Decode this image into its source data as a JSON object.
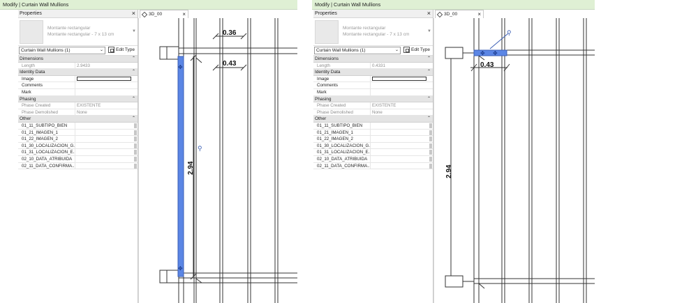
{
  "left": {
    "titlebar": "Modify | Curtain Wall Mullions",
    "properties": {
      "header": "Properties",
      "type_line1": "Montante rectangular",
      "type_line2": "Montante rectangular - 7 x 13 cm",
      "selector": "Curtain Wall Mullions (1)",
      "edit_type": "Edit Type",
      "groups": {
        "dimensions": "Dimensions",
        "identity": "Identity Data",
        "phasing": "Phasing",
        "other": "Other"
      },
      "length": {
        "key": "Length",
        "value": "2.9433"
      },
      "identity_rows": [
        "Image",
        "Comments",
        "Mark"
      ],
      "phase_created": {
        "key": "Phase Created",
        "value": "EXISTENTE"
      },
      "phase_demolished": {
        "key": "Phase Demolished",
        "value": "None"
      },
      "other_rows": [
        "01_11_SUBTIPO_BIEN",
        "01_21_IMAGEN_1",
        "01_22_IMAGEN_2",
        "01_30_LOCALIZACION_G...",
        "01_31_LOCALIZACION_E...",
        "02_10_DATA_ATRIBUIDA",
        "02_11_DATA_CONFIRMA..."
      ]
    },
    "view_tab": "3D_00",
    "dims": {
      "top": "0.36",
      "mid": "0.43",
      "vertical": "2.94"
    }
  },
  "right": {
    "titlebar": "Modify | Curtain Wall Mullions",
    "properties": {
      "header": "Properties",
      "type_line1": "Montante rectangular",
      "type_line2": "Montante rectangular - 7 x 13 cm",
      "selector": "Curtain Wall Mullions (1)",
      "edit_type": "Edit Type",
      "groups": {
        "dimensions": "Dimensions",
        "identity": "Identity Data",
        "phasing": "Phasing",
        "other": "Other"
      },
      "length": {
        "key": "Length",
        "value": "0.4331"
      },
      "identity_rows": [
        "Image",
        "Comments",
        "Mark"
      ],
      "phase_created": {
        "key": "Phase Created",
        "value": "EXISTENTE"
      },
      "phase_demolished": {
        "key": "Phase Demolished",
        "value": "None"
      },
      "other_rows": [
        "01_11_SUBTIPO_BIEN",
        "01_21_IMAGEN_1",
        "01_22_IMAGEN_2",
        "01_30_LOCALIZACION_G...",
        "01_31_LOCALIZACION_E...",
        "02_10_DATA_ATRIBUIDA",
        "02_11_DATA_CONFIRMA..."
      ]
    },
    "view_tab": "3D_00",
    "dims": {
      "mid": "0.43",
      "vertical": "2.94"
    }
  },
  "colors": {
    "selection": "#5b86e5",
    "titlebar": "#dff0d4"
  }
}
